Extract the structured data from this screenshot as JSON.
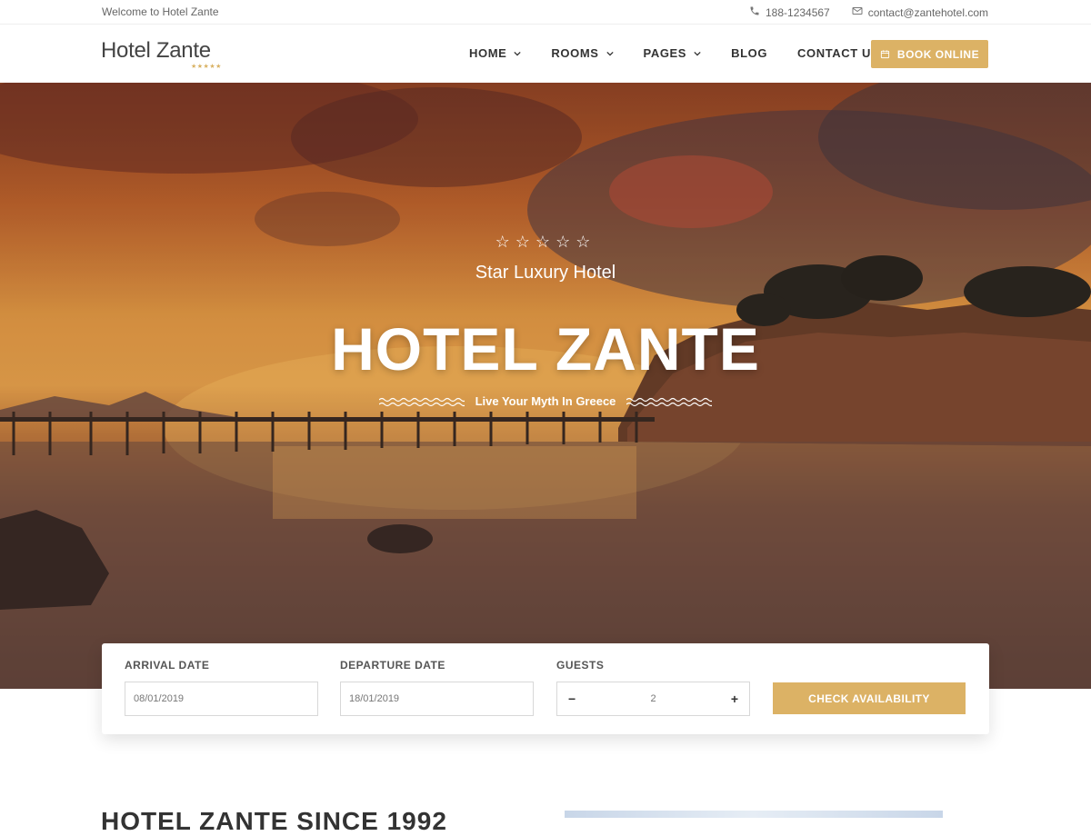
{
  "topbar": {
    "welcome": "Welcome to Hotel Zante",
    "phone": "188-1234567",
    "email": "contact@zantehotel.com"
  },
  "header": {
    "logo_text": "Hotel Zante",
    "logo_stars": "★★★★★",
    "nav": [
      {
        "label": "HOME",
        "has_dropdown": true
      },
      {
        "label": "ROOMS",
        "has_dropdown": true
      },
      {
        "label": "PAGES",
        "has_dropdown": true
      },
      {
        "label": "BLOG",
        "has_dropdown": false
      },
      {
        "label": "CONTACT US",
        "has_dropdown": false
      }
    ],
    "book_button": "BOOK ONLINE"
  },
  "hero": {
    "stars": "☆☆☆☆☆",
    "subtitle": "Star Luxury Hotel",
    "title": "HOTEL ZANTE",
    "tagline": "Live Your Myth In Greece"
  },
  "booking": {
    "arrival_label": "ARRIVAL DATE",
    "arrival_value": "08/01/2019",
    "departure_label": "DEPARTURE DATE",
    "departure_value": "18/01/2019",
    "guests_label": "GUESTS",
    "guests_value": "2",
    "minus": "−",
    "plus": "+",
    "check_button": "CHECK AVAILABILITY"
  },
  "section": {
    "heading": "HOTEL ZANTE SINCE 1992"
  },
  "colors": {
    "accent": "#dcb265",
    "text": "#333333"
  },
  "icons": [
    "phone-icon",
    "envelope-icon",
    "chevron-down-icon",
    "calendar-icon",
    "wave-icon"
  ]
}
